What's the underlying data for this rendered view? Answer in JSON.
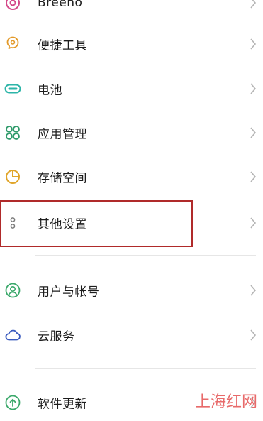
{
  "settings": {
    "items": [
      {
        "label": "Breeno",
        "icon": "breeno-icon"
      },
      {
        "label": "便捷工具",
        "icon": "convenience-tools-icon"
      },
      {
        "label": "电池",
        "icon": "battery-icon"
      },
      {
        "label": "应用管理",
        "icon": "app-management-icon"
      },
      {
        "label": "存储空间",
        "icon": "storage-icon"
      },
      {
        "label": "其他设置",
        "icon": "other-settings-icon"
      },
      {
        "label": "用户与帐号",
        "icon": "user-account-icon"
      },
      {
        "label": "云服务",
        "icon": "cloud-icon"
      },
      {
        "label": "软件更新",
        "icon": "software-update-icon"
      }
    ]
  },
  "highlight_color": "#b02a2a",
  "watermark": "上海红网"
}
